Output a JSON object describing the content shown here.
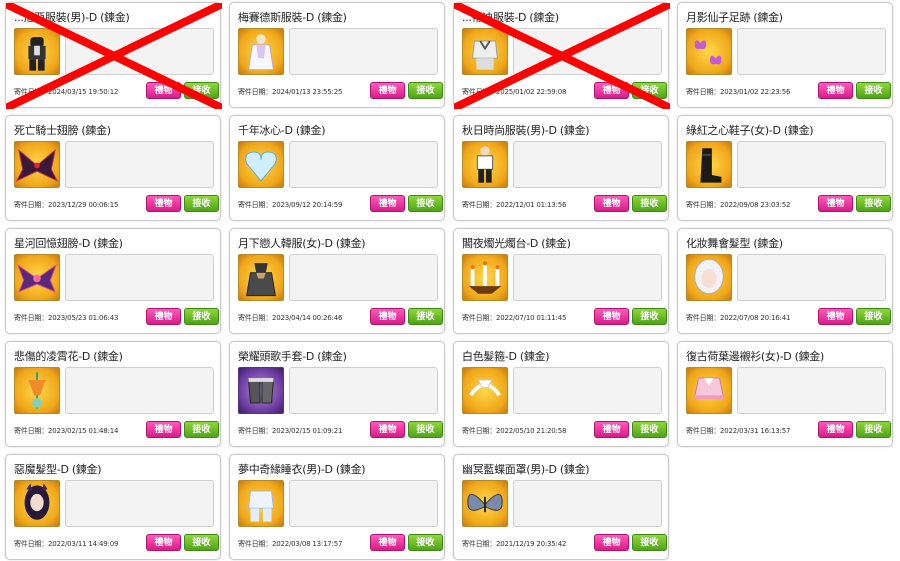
{
  "labels": {
    "date_prefix": "寄件日期：",
    "gift": "禮物",
    "receive": "接收"
  },
  "colors": {
    "gift_button": "#e02896",
    "receive_button": "#5fb41f",
    "strike": "#ff0000"
  },
  "cards": [
    {
      "title": "...尼亞服裝(男)-D (鍊金)",
      "date": "2024/03/15 19:50:12",
      "icon": "outfit-male-black-icon",
      "struck": true
    },
    {
      "title": "梅賽德斯服裝-D (鍊金)",
      "date": "2024/01/13 23:55:25",
      "icon": "outfit-white-icon",
      "struck": false
    },
    {
      "title": "...蒂迪服裝-D (鍊金)",
      "date": "2025/01/02 22:59:08",
      "icon": "outfit-sweater-icon",
      "struck": true
    },
    {
      "title": "月影仙子足跡 (鍊金)",
      "date": "2023/01/02 22:23:56",
      "icon": "butterfly-footprint-icon",
      "struck": false
    },
    {
      "title": "死亡騎士翅膀 (鍊金)",
      "date": "2023/12/29 00:06:15",
      "icon": "dark-wings-icon",
      "struck": false
    },
    {
      "title": "千年冰心-D (鍊金)",
      "date": "2023/09/12 20:14:59",
      "icon": "ice-heart-icon",
      "struck": false
    },
    {
      "title": "秋日時尚服裝(男)-D (鍊金)",
      "date": "2022/12/01 01:13:56",
      "icon": "autumn-outfit-icon",
      "struck": false
    },
    {
      "title": "綠紅之心鞋子(女)-D (鍊金)",
      "date": "2022/09/08 23:03:52",
      "icon": "boots-icon",
      "struck": false
    },
    {
      "title": "星河回憶翅膀-D (鍊金)",
      "date": "2023/05/23 01:06:43",
      "icon": "galaxy-wings-icon",
      "struck": false
    },
    {
      "title": "月下戀人韓服(女)-D (鍊金)",
      "date": "2023/04/14 00:26:46",
      "icon": "hanbok-icon",
      "struck": false
    },
    {
      "title": "閣夜燭光燭台-D (鍊金)",
      "date": "2022/07/10 01:11:45",
      "icon": "candelabra-icon",
      "struck": false
    },
    {
      "title": "化妝舞會髮型 (鍊金)",
      "date": "2022/07/08 20:16:41",
      "icon": "masquerade-hair-icon",
      "struck": false
    },
    {
      "title": "悲傷的凌霄花-D (鍊金)",
      "date": "2023/02/15 01:48:14",
      "icon": "trumpet-flower-icon",
      "struck": false
    },
    {
      "title": "榮耀頭歌手套-D (鍊金)",
      "date": "2023/02/15 01:09:21",
      "icon": "gloves-icon",
      "struck": false
    },
    {
      "title": "白色髮箍-D (鍊金)",
      "date": "2022/05/10 21:20:58",
      "icon": "white-headband-icon",
      "struck": false
    },
    {
      "title": "復古荷葉邊襯衫(女)-D (鍊金)",
      "date": "2022/03/31 16:13:57",
      "icon": "ruffle-shirt-icon",
      "struck": false
    },
    {
      "title": "惡魔髮型-D (鍊金)",
      "date": "2022/03/11 14:49:09",
      "icon": "demon-hair-icon",
      "struck": false
    },
    {
      "title": "夢中奇緣睡衣(男)-D (鍊金)",
      "date": "2022/03/08 13:17:57",
      "icon": "pajamas-icon",
      "struck": false
    },
    {
      "title": "幽冥藍蝶面罩(男)-D (鍊金)",
      "date": "2021/12/19 20:35:42",
      "icon": "butterfly-mask-icon",
      "struck": false
    }
  ]
}
